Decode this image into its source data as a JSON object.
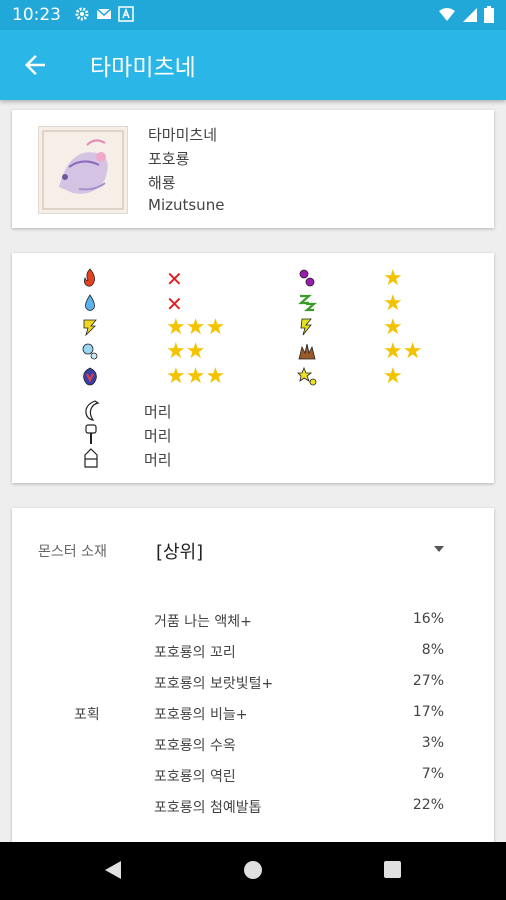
{
  "status_bar": {
    "time": "10:23"
  },
  "app_bar": {
    "title": "타마미츠네"
  },
  "monster": {
    "names": [
      "타마미츠네",
      "포호룡",
      "해룡",
      "Mizutsune"
    ]
  },
  "weakness": {
    "left": [
      {
        "element": "fire",
        "value": "✕"
      },
      {
        "element": "water",
        "value": "✕"
      },
      {
        "element": "thunder",
        "value": "★★★"
      },
      {
        "element": "ice",
        "value": "★★"
      },
      {
        "element": "dragon",
        "value": "★★★"
      }
    ],
    "right": [
      {
        "element": "poison",
        "value": "★"
      },
      {
        "element": "sleep",
        "value": "★"
      },
      {
        "element": "paralysis",
        "value": "★"
      },
      {
        "element": "blast",
        "value": "★★"
      },
      {
        "element": "stun",
        "value": "★"
      }
    ]
  },
  "parts": [
    {
      "type": "sever",
      "label": "머리"
    },
    {
      "type": "blunt",
      "label": "머리"
    },
    {
      "type": "shot",
      "label": "머리"
    }
  ],
  "materials": {
    "label": "몬스터 소재",
    "rank": "[상위]",
    "method": "포획",
    "items": [
      {
        "name": "거품 나는 액체+",
        "rate": "16%"
      },
      {
        "name": "포호룡의 꼬리",
        "rate": "8%"
      },
      {
        "name": "포호룡의 보랏빛털+",
        "rate": "27%"
      },
      {
        "name": "포호룡의 비늘+",
        "rate": "17%"
      },
      {
        "name": "포호룡의 수옥",
        "rate": "3%"
      },
      {
        "name": "포호룡의 역린",
        "rate": "7%"
      },
      {
        "name": "포호룡의 첨예발톱",
        "rate": "22%"
      }
    ]
  }
}
